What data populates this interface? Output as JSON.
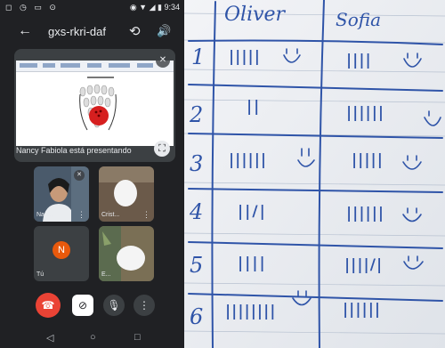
{
  "status_bar": {
    "left_icons": "◻ ◷ ▭ ⊙",
    "right_icons": "◉ ▼ ◢ ▮",
    "time": "9:34"
  },
  "app_bar": {
    "meeting_code": "gxs-rkri-daf",
    "back_icon": "←",
    "camera_switch_icon": "⟲",
    "volume_icon": "🔊"
  },
  "presentation": {
    "presenting_text": "Nancy Fabiola está presentando",
    "doc_heading": "Bowling sheet"
  },
  "participants": [
    {
      "name": "Nan...",
      "avatar_letter": ""
    },
    {
      "name": "Crist...",
      "avatar_letter": ""
    },
    {
      "name": "Tú",
      "avatar_letter": "N",
      "avatar_color": "#e8590c"
    },
    {
      "name": "E...",
      "avatar_letter": ""
    }
  ],
  "controls": {
    "hangup_icon": "☎",
    "camera_off_icon": "⊘",
    "mic_icon": "🎙",
    "more_icon": "⋮"
  },
  "nav": {
    "back": "◁",
    "home": "○",
    "recent": "□"
  },
  "notebook": {
    "columns": [
      "Oliver",
      "Sofia"
    ],
    "rows": [
      {
        "n": "1",
        "oliver": "|||||",
        "sofia": "||||"
      },
      {
        "n": "2",
        "oliver": "||",
        "sofia": "||||||"
      },
      {
        "n": "3",
        "oliver": "||||||",
        "sofia": "|||||"
      },
      {
        "n": "4",
        "oliver": "||/|",
        "sofia": "||||||"
      },
      {
        "n": "5",
        "oliver": "||||",
        "sofia": "||||/|"
      },
      {
        "n": "6",
        "oliver": "||||||||",
        "sofia": "||||||"
      }
    ],
    "ink_color": "#2f54a8"
  }
}
